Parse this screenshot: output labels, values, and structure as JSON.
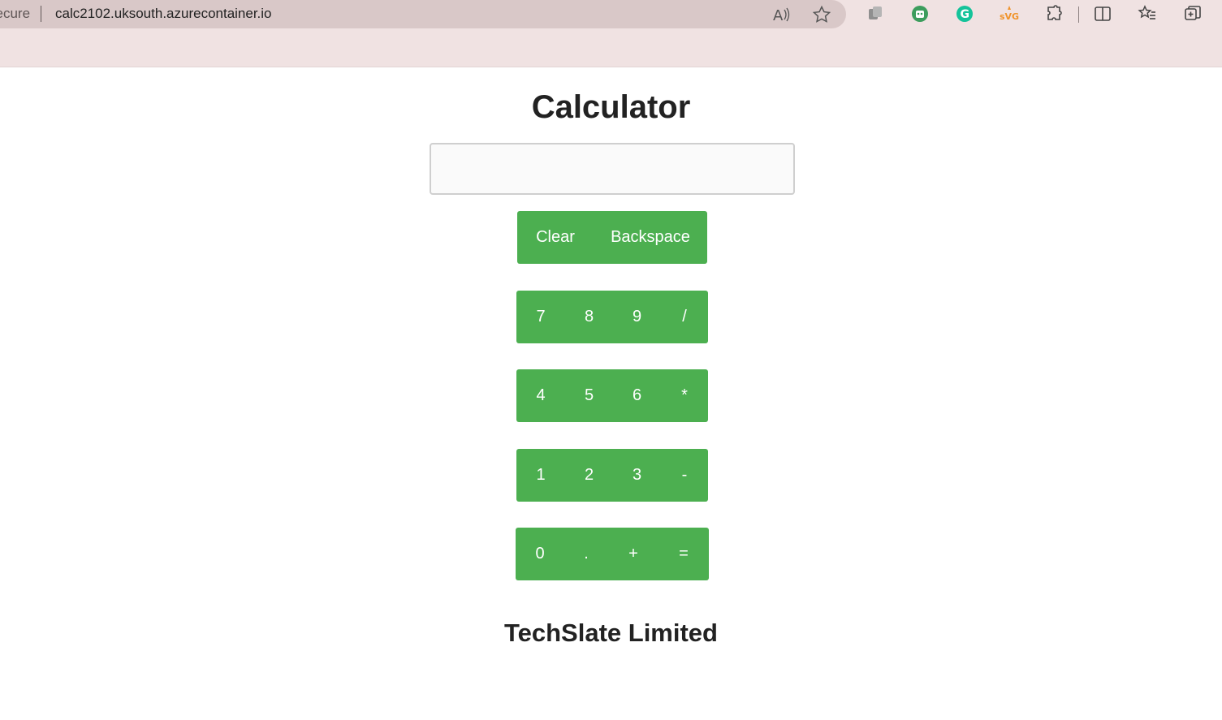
{
  "browser": {
    "security_label": "secure",
    "url": "calc2102.uksouth.azurecontainer.io"
  },
  "app": {
    "title": "Calculator",
    "display_value": "",
    "footer": "TechSlate Limited"
  },
  "buttons": {
    "clear": "Clear",
    "backspace": "Backspace",
    "rows": [
      [
        "7",
        "8",
        "9",
        "/"
      ],
      [
        "4",
        "5",
        "6",
        "*"
      ],
      [
        "1",
        "2",
        "3",
        "-"
      ],
      [
        "0",
        ".",
        "+",
        "="
      ]
    ]
  },
  "colors": {
    "button_green": "#4caf50",
    "chrome_bg": "#f0e2e2"
  }
}
